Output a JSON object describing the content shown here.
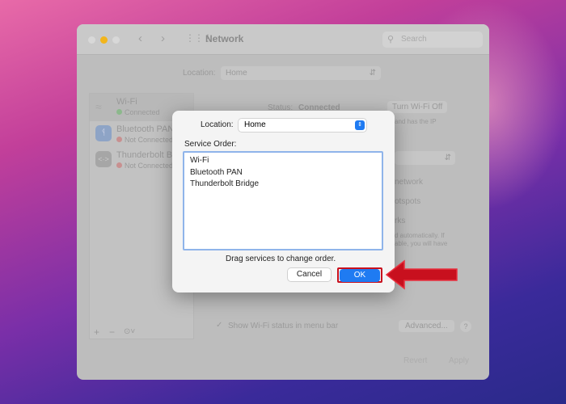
{
  "window": {
    "title": "Network",
    "search_placeholder": "Search"
  },
  "background": {
    "location_label": "Location:",
    "location_value": "Home",
    "services": [
      {
        "name": "Wi-Fi",
        "status": "Connected",
        "status_color": "#4caf50"
      },
      {
        "name": "Bluetooth PAN",
        "status": "Not Connected",
        "status_color": "#e05050"
      },
      {
        "name": "Thunderbolt Bridge",
        "status": "Not Connected",
        "status_color": "#e05050"
      }
    ],
    "status_label": "Status:",
    "status_value": "Connected",
    "turn_off": "Turn Wi-Fi Off",
    "ip_text": "and has the IP",
    "frag_network": "network",
    "frag_hotspots": "otspots",
    "frag_networks": "rks",
    "frag_auto1": "d automatically. If",
    "frag_auto2": "able, you will have",
    "show_status": "Show Wi-Fi status in menu bar",
    "advanced": "Advanced...",
    "help": "?",
    "revert": "Revert",
    "apply": "Apply",
    "add": "+",
    "remove": "−"
  },
  "dialog": {
    "location_label": "Location:",
    "location_value": "Home",
    "service_order_label": "Service Order:",
    "services": [
      "Wi-Fi",
      "Bluetooth PAN",
      "Thunderbolt Bridge"
    ],
    "hint": "Drag services to change order.",
    "cancel": "Cancel",
    "ok": "OK"
  },
  "colors": {
    "accent": "#1f7bf2",
    "highlight": "#c8101e"
  }
}
